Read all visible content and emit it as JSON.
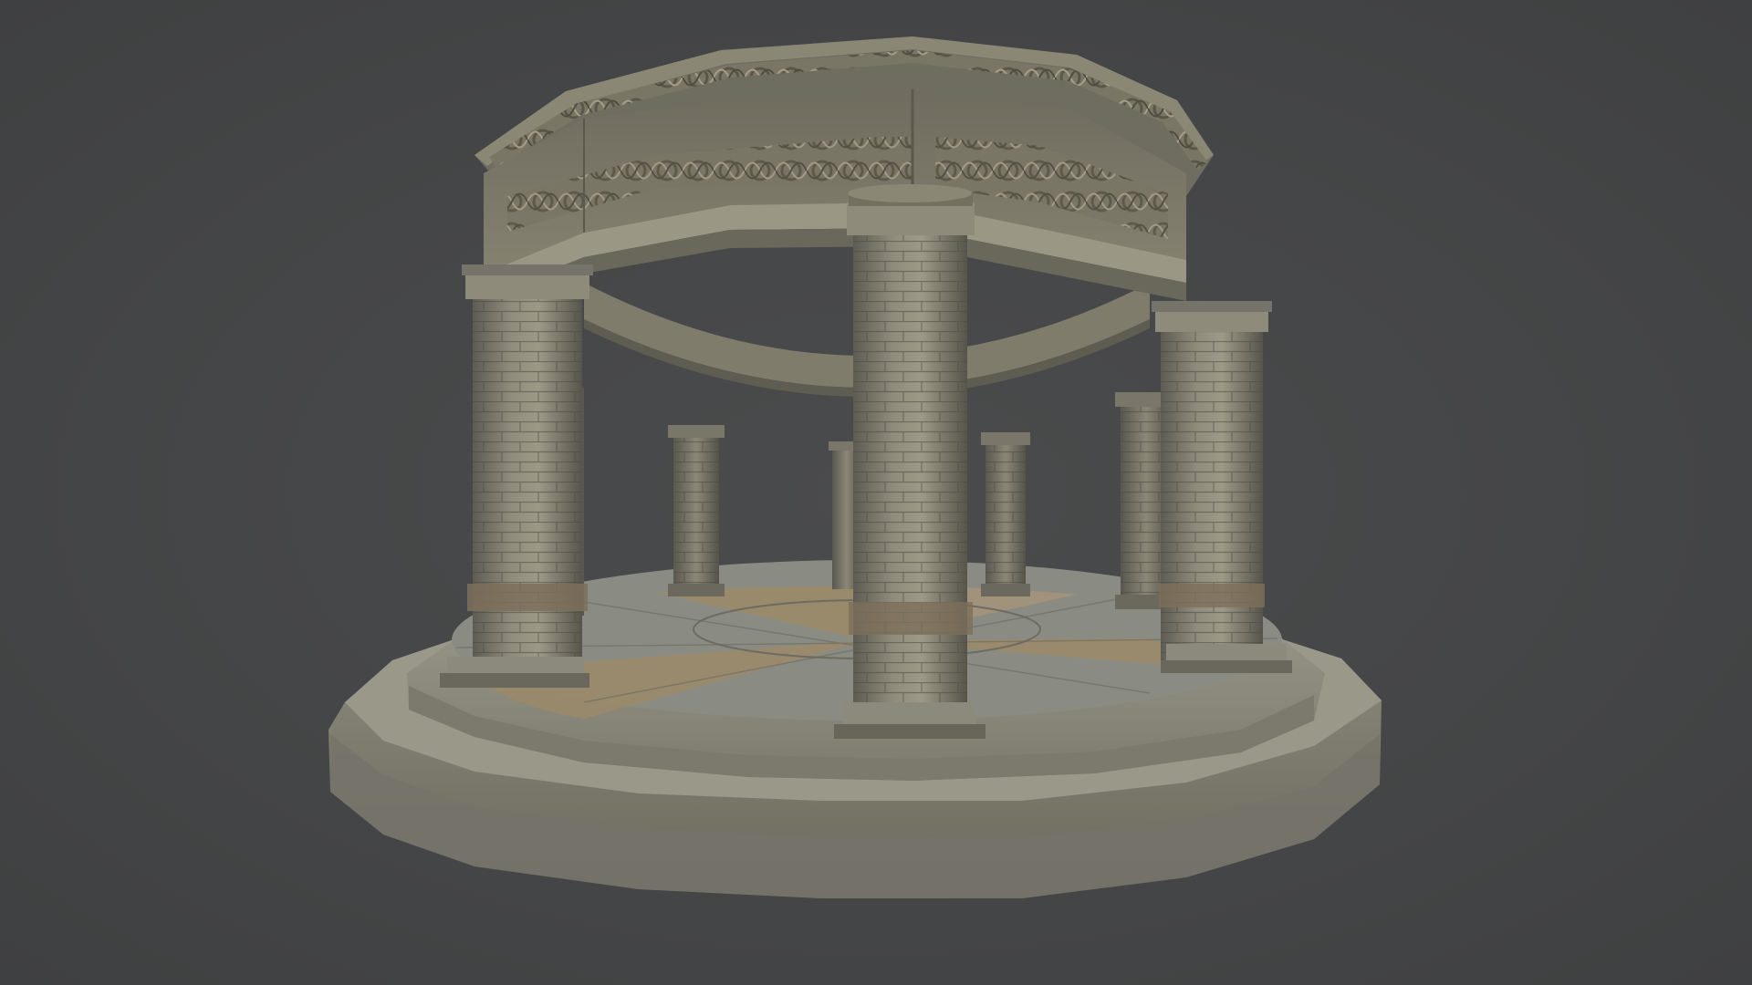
{
  "viewport": {
    "background_color": "#454647"
  },
  "model": {
    "subject": "stone-rotunda",
    "stone_color": "#8d8a78",
    "stone_dark": "#5d5b50",
    "stone_light": "#a9a694",
    "floor_tan": "#9b8a6a",
    "floor_grey": "#8a8c84",
    "column_count": 8,
    "step_count": 2
  }
}
